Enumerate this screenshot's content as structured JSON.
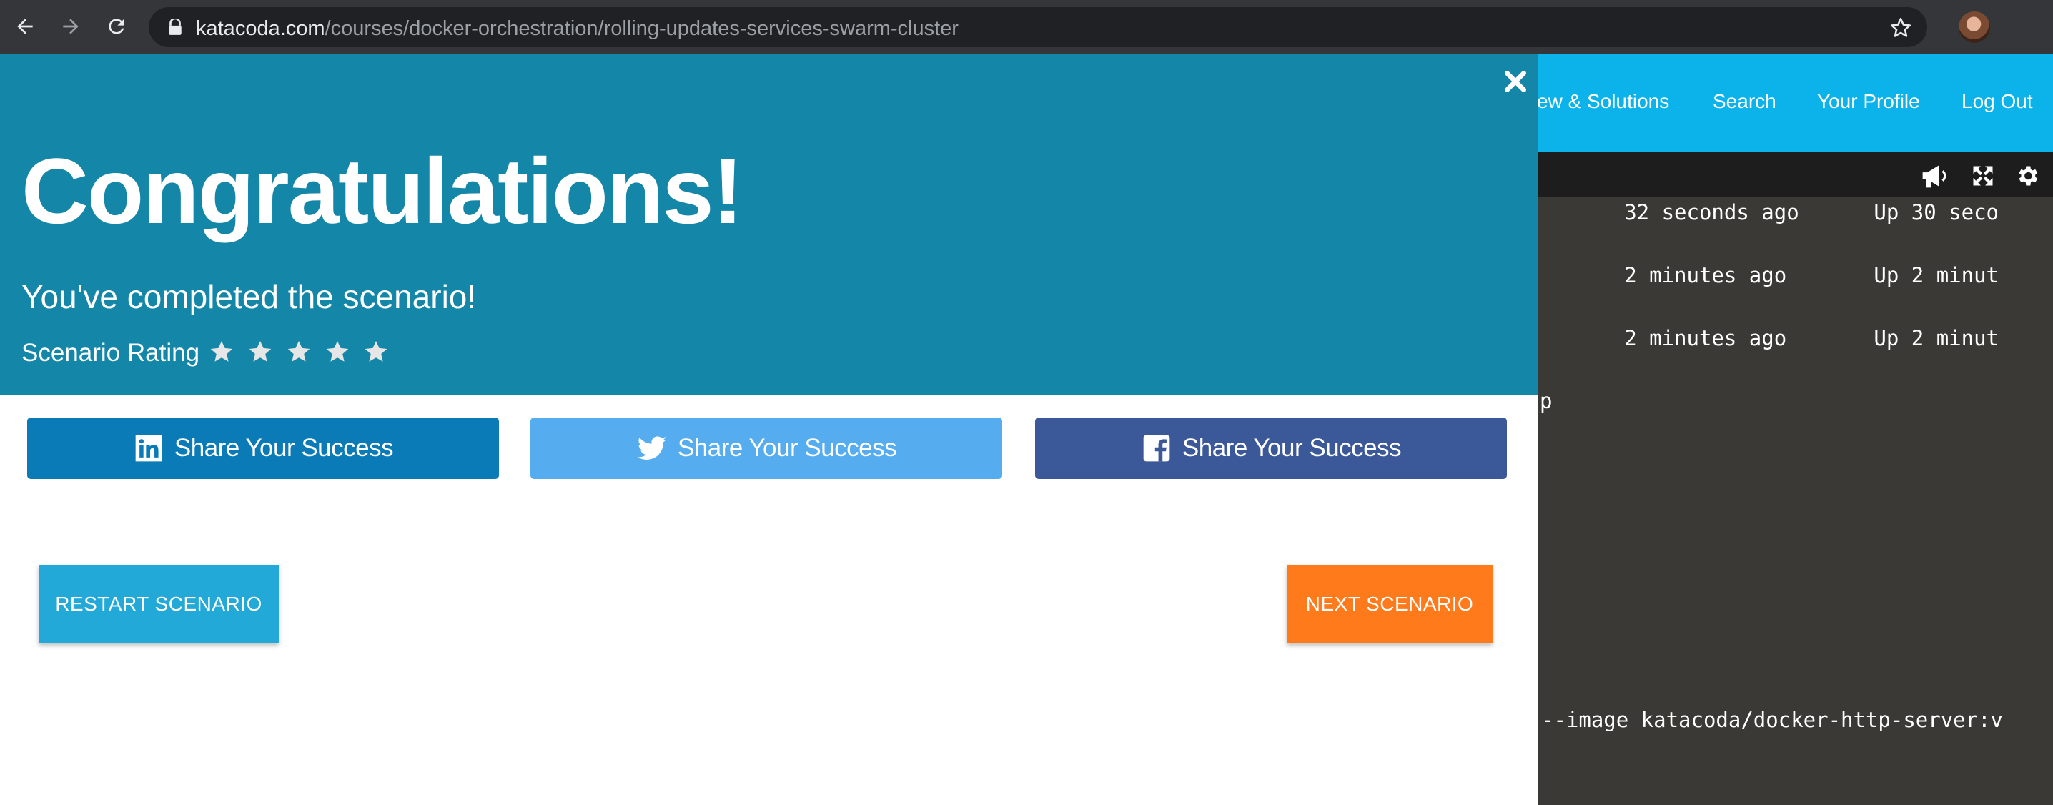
{
  "browser": {
    "url_host": "katacoda.com",
    "url_path": "/courses/docker-orchestration/rolling-updates-services-swarm-cluster",
    "icons": [
      "back-icon",
      "forward-icon",
      "reload-icon",
      "lock-icon",
      "bookmark-star-icon",
      "profile-avatar"
    ]
  },
  "topnav": {
    "links": [
      "ew & Solutions",
      "Search",
      "Your Profile",
      "Log Out"
    ],
    "color": "#0cb3ea"
  },
  "terminal": {
    "toolbar_icons": [
      "megaphone-icon",
      "fullscreen-icon",
      "settings-icon"
    ],
    "lines": [
      "       32 seconds ago      Up 30 seco",
      "       2 minutes ago       Up 2 minut",
      "       2 minutes ago       Up 2 minut",
      "p",
      "--image katacoda/docker-http-server:v"
    ]
  },
  "modal": {
    "title": "Congratulations!",
    "subtitle": "You've completed the scenario!",
    "rating_label": "Scenario Rating",
    "stars": 5,
    "header_color": "#1487a8",
    "share": {
      "linkedin_label": "Share Your Success",
      "twitter_label": "Share Your Success",
      "facebook_label": "Share Your Success"
    },
    "restart_label": "RESTART SCENARIO",
    "next_label": "NEXT SCENARIO",
    "colors": {
      "linkedin": "#0a7bb6",
      "twitter": "#55acee",
      "facebook": "#3b5998",
      "restart": "#23a9d8",
      "next": "#fe7a1b"
    }
  }
}
